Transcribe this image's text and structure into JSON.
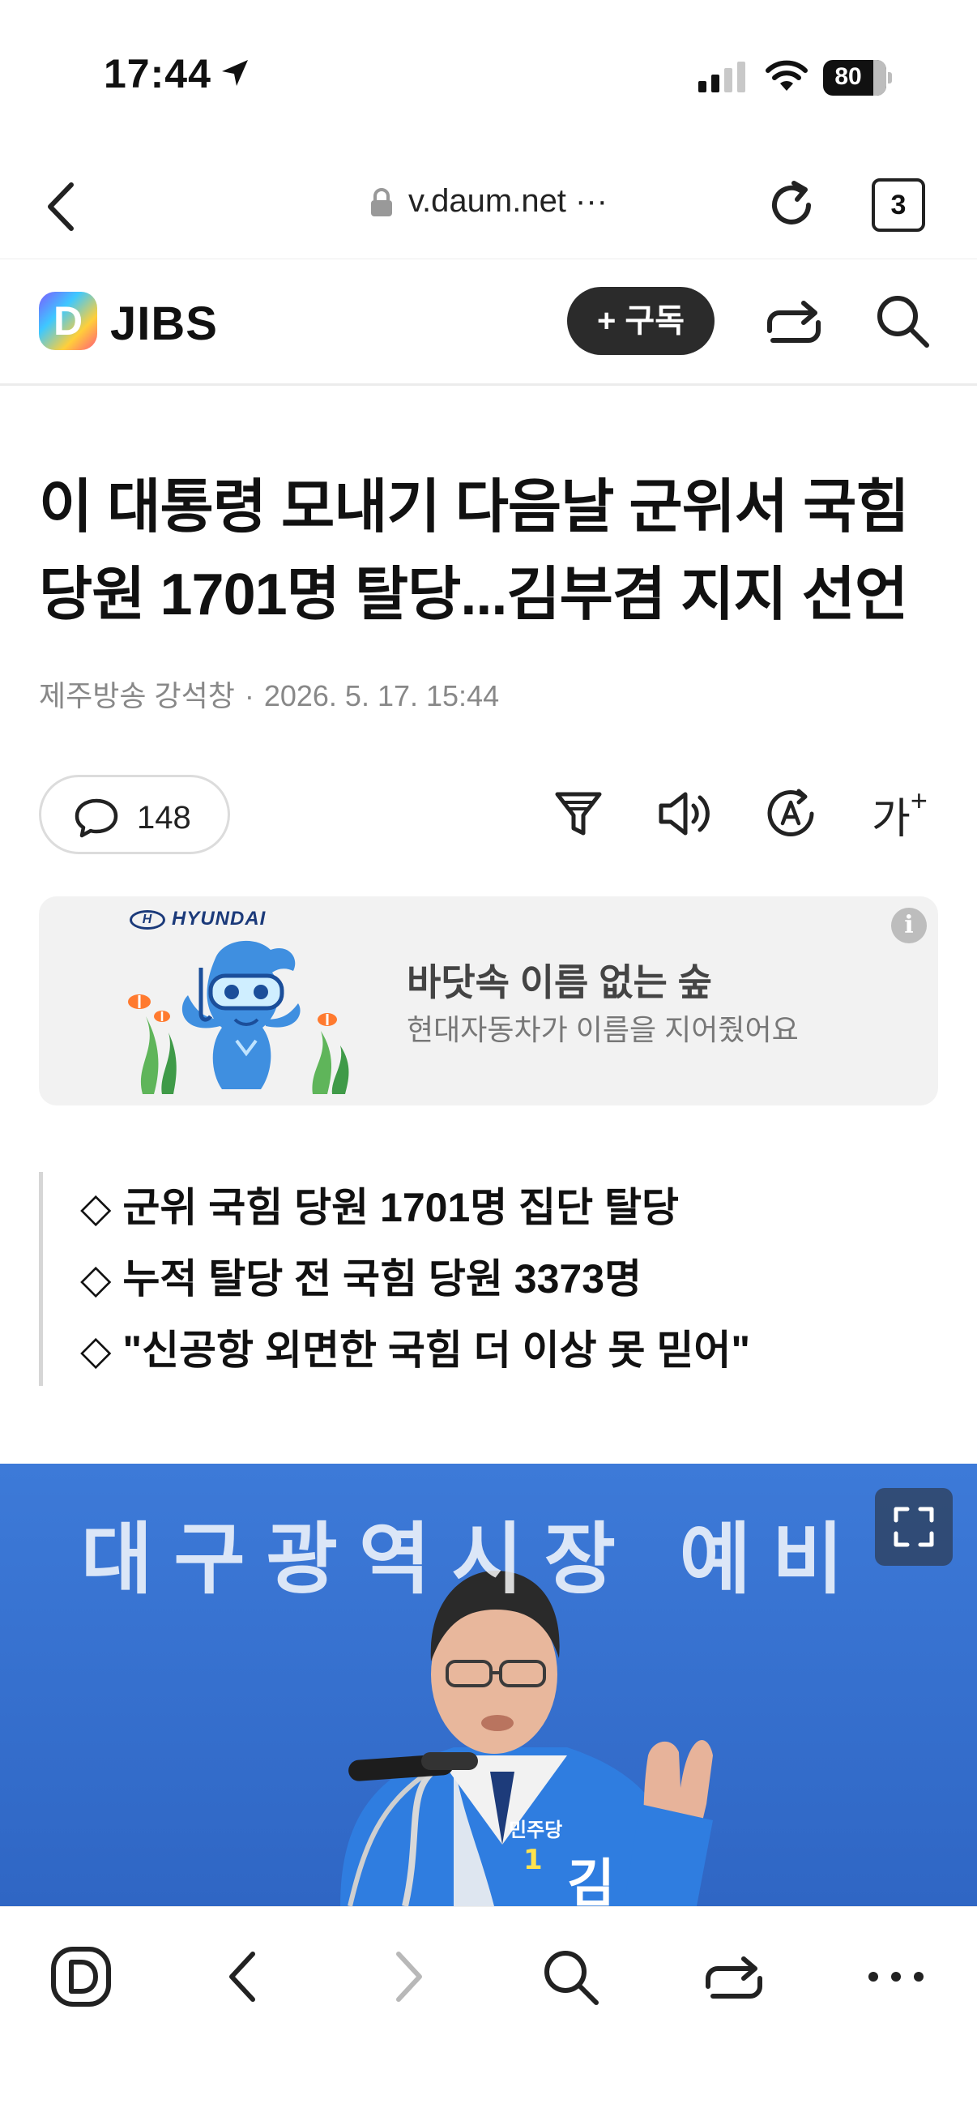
{
  "status_bar": {
    "time": "17:44",
    "battery": "80"
  },
  "browser": {
    "url": "v.daum.net ···",
    "tab_count": "3"
  },
  "site": {
    "logo_letter": "D",
    "brand": "JIBS",
    "subscribe_label": "+ 구독"
  },
  "article": {
    "headline": "이 대통령 모내기 다음날 군위서 국힘 당원 1701명 탈당...김부겸 지지 선언",
    "source": "제주방송 강석창",
    "dot": "·",
    "date": "2026. 5. 17. 15:44",
    "comment_count": "148",
    "font_size_label": "가",
    "summary": [
      "◇ 군위 국힘 당원 1701명 집단 탈당",
      "◇ 누적 탈당 전 국힘 당원 3373명",
      "◇ \"신공항 외면한 국힘 더 이상 못 믿어\""
    ],
    "photo_banner_text": "대구광역시장 예비"
  },
  "ad": {
    "brand": "HYUNDAI",
    "title": "바닷속 이름 없는 숲",
    "subtitle": "현대자동차가 이름을 지어줬어요",
    "info": "i"
  },
  "icons": {
    "location": "location-arrow-icon",
    "signal": "cellular-signal-icon",
    "wifi": "wifi-icon",
    "lock": "lock-icon",
    "reload": "reload-icon",
    "share": "share-icon",
    "search": "search-icon",
    "comment": "comment-bubble-icon",
    "summary": "summary-filter-icon",
    "audio": "speaker-icon",
    "translate": "translate-icon",
    "expand": "expand-icon"
  },
  "colors": {
    "subscribe_bg": "#2b2b2b",
    "ad_bg": "#f2f2f2",
    "photo_bg": "#3a76d6",
    "meta_text": "#888888"
  }
}
